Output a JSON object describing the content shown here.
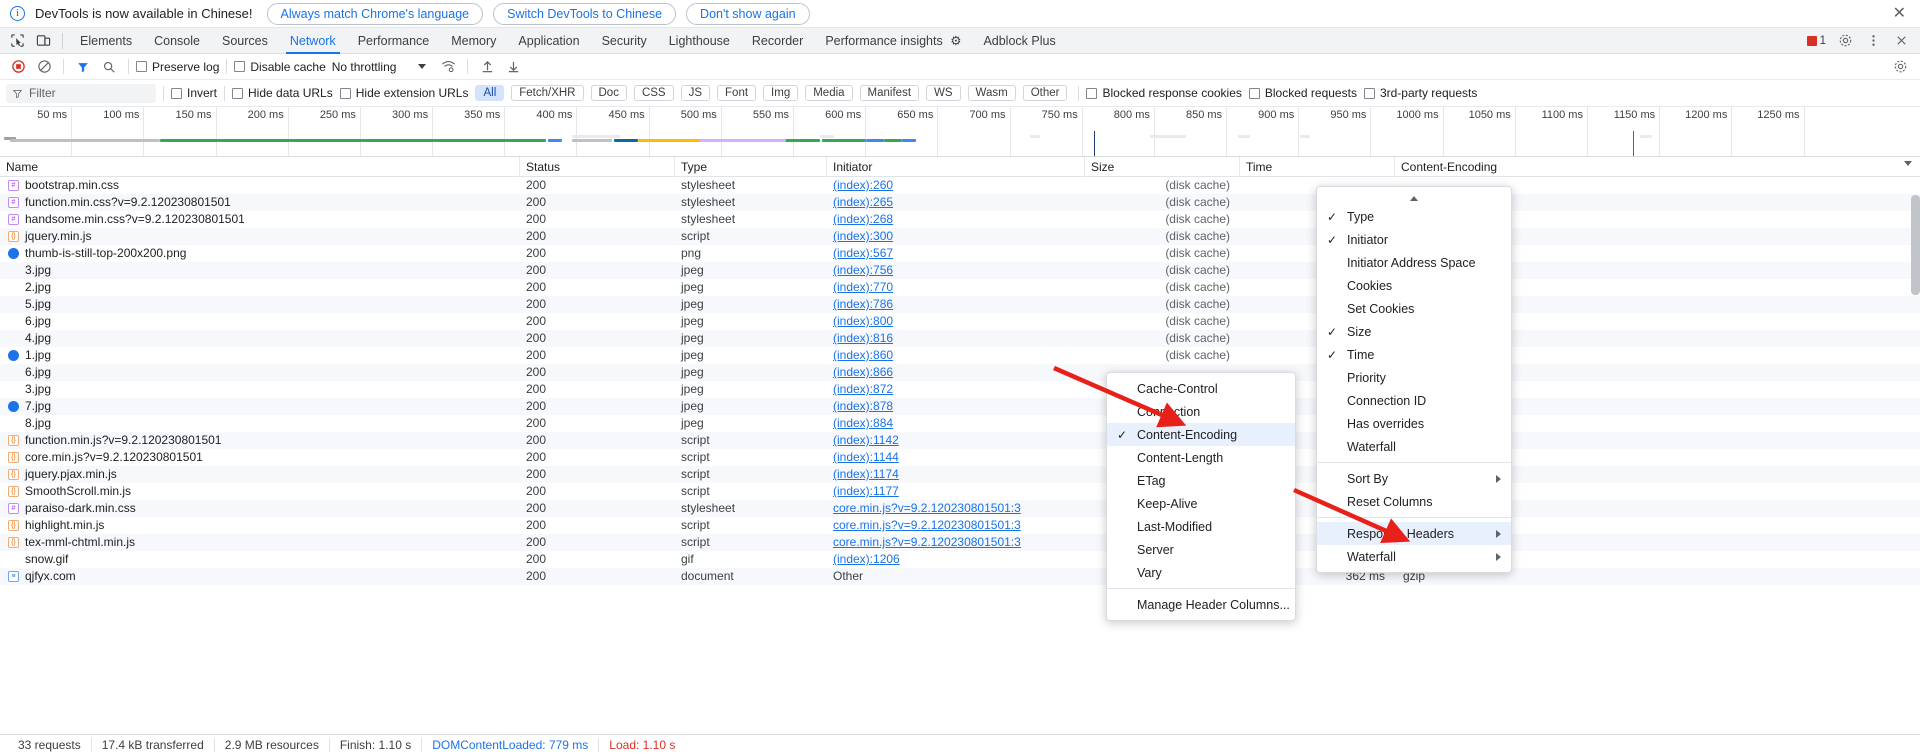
{
  "infobar": {
    "message": "DevTools is now available in Chinese!",
    "buttons": [
      "Always match Chrome's language",
      "Switch DevTools to Chinese",
      "Don't show again"
    ],
    "close": "✕"
  },
  "tabs": {
    "items": [
      "Elements",
      "Console",
      "Sources",
      "Network",
      "Performance",
      "Memory",
      "Application",
      "Security",
      "Lighthouse",
      "Recorder",
      "Performance insights",
      "Adblock Plus"
    ],
    "active": "Network",
    "error_count": "1",
    "settings_icon": "gear-icon",
    "more_icon": "kebab-icon",
    "close_icon": "close-icon"
  },
  "toolbar": {
    "record_icon": "record-stop-icon",
    "clear_icon": "clear-icon",
    "filter_icon": "filter-icon",
    "search_icon": "search-icon",
    "preserve_log": "Preserve log",
    "disable_cache": "Disable cache",
    "throttling": "No throttling",
    "wifi_icon": "network-conditions-icon",
    "import_icon": "import-har-icon",
    "export_icon": "export-har-icon",
    "settings_icon": "settings-gear-icon"
  },
  "filterbar": {
    "placeholder": "Filter",
    "invert": "Invert",
    "hide_data_urls": "Hide data URLs",
    "hide_extension_urls": "Hide extension URLs",
    "types": [
      "All",
      "Fetch/XHR",
      "Doc",
      "CSS",
      "JS",
      "Font",
      "Img",
      "Media",
      "Manifest",
      "WS",
      "Wasm",
      "Other"
    ],
    "selected_type": "All",
    "blocked_response_cookies": "Blocked response cookies",
    "blocked_requests": "Blocked requests",
    "third_party_requests": "3rd-party requests"
  },
  "timeline": {
    "ticks": [
      "50 ms",
      "100 ms",
      "150 ms",
      "200 ms",
      "250 ms",
      "300 ms",
      "350 ms",
      "400 ms",
      "450 ms",
      "500 ms",
      "550 ms",
      "600 ms",
      "650 ms",
      "700 ms",
      "750 ms",
      "800 ms",
      "850 ms",
      "900 ms",
      "950 ms",
      "1000 ms",
      "1050 ms",
      "1100 ms",
      "1150 ms",
      "1200 ms",
      "1250 ms"
    ]
  },
  "table": {
    "columns": [
      "Name",
      "Status",
      "Type",
      "Initiator",
      "Size",
      "Time",
      "Content-Encoding"
    ],
    "rows": [
      {
        "icon": "css",
        "name": "bootstrap.min.css",
        "status": "200",
        "type": "stylesheet",
        "initiator": "(index):260",
        "size": "(disk cache)",
        "time": "",
        "enc": ""
      },
      {
        "icon": "css",
        "name": "function.min.css?v=9.2.120230801501",
        "status": "200",
        "type": "stylesheet",
        "initiator": "(index):265",
        "size": "(disk cache)",
        "time": "",
        "enc": ""
      },
      {
        "icon": "css",
        "name": "handsome.min.css?v=9.2.120230801501",
        "status": "200",
        "type": "stylesheet",
        "initiator": "(index):268",
        "size": "(disk cache)",
        "time": "",
        "enc": ""
      },
      {
        "icon": "js",
        "name": "jquery.min.js",
        "status": "200",
        "type": "script",
        "initiator": "(index):300",
        "size": "(disk cache)",
        "time": "",
        "enc": ""
      },
      {
        "icon": "img-globe",
        "name": "thumb-is-still-top-200x200.png",
        "status": "200",
        "type": "png",
        "initiator": "(index):567",
        "size": "(disk cache)",
        "time": "",
        "enc": ""
      },
      {
        "icon": "dash",
        "name": "3.jpg",
        "status": "200",
        "type": "jpeg",
        "initiator": "(index):756",
        "size": "(disk cache)",
        "time": "",
        "enc": ""
      },
      {
        "icon": "dash",
        "name": "2.jpg",
        "status": "200",
        "type": "jpeg",
        "initiator": "(index):770",
        "size": "(disk cache)",
        "time": "",
        "enc": ""
      },
      {
        "icon": "dash",
        "name": "5.jpg",
        "status": "200",
        "type": "jpeg",
        "initiator": "(index):786",
        "size": "(disk cache)",
        "time": "",
        "enc": ""
      },
      {
        "icon": "dash",
        "name": "6.jpg",
        "status": "200",
        "type": "jpeg",
        "initiator": "(index):800",
        "size": "(disk cache)",
        "time": "",
        "enc": ""
      },
      {
        "icon": "dash",
        "name": "4.jpg",
        "status": "200",
        "type": "jpeg",
        "initiator": "(index):816",
        "size": "(disk cache)",
        "time": "",
        "enc": ""
      },
      {
        "icon": "img-globe",
        "name": "1.jpg",
        "status": "200",
        "type": "jpeg",
        "initiator": "(index):860",
        "size": "(disk cache)",
        "time": "",
        "enc": ""
      },
      {
        "icon": "dash",
        "name": "6.jpg",
        "status": "200",
        "type": "jpeg",
        "initiator": "(index):866",
        "size": "",
        "time": "",
        "enc": ""
      },
      {
        "icon": "dash",
        "name": "3.jpg",
        "status": "200",
        "type": "jpeg",
        "initiator": "(index):872",
        "size": "",
        "time": "",
        "enc": ""
      },
      {
        "icon": "img-globe",
        "name": "7.jpg",
        "status": "200",
        "type": "jpeg",
        "initiator": "(index):878",
        "size": "",
        "time": "",
        "enc": ""
      },
      {
        "icon": "dash",
        "name": "8.jpg",
        "status": "200",
        "type": "jpeg",
        "initiator": "(index):884",
        "size": "",
        "time": "",
        "enc": ""
      },
      {
        "icon": "js",
        "name": "function.min.js?v=9.2.120230801501",
        "status": "200",
        "type": "script",
        "initiator": "(index):1142",
        "size": "",
        "time": "",
        "enc": ""
      },
      {
        "icon": "js",
        "name": "core.min.js?v=9.2.120230801501",
        "status": "200",
        "type": "script",
        "initiator": "(index):1144",
        "size": "",
        "time": "",
        "enc": ""
      },
      {
        "icon": "js",
        "name": "jquery.pjax.min.js",
        "status": "200",
        "type": "script",
        "initiator": "(index):1174",
        "size": "",
        "time": "",
        "enc": ""
      },
      {
        "icon": "js",
        "name": "SmoothScroll.min.js",
        "status": "200",
        "type": "script",
        "initiator": "(index):1177",
        "size": "",
        "time": "",
        "enc": ""
      },
      {
        "icon": "css",
        "name": "paraiso-dark.min.css",
        "status": "200",
        "type": "stylesheet",
        "initiator": "core.min.js?v=9.2.120230801501:3",
        "size": "",
        "time": "",
        "enc": ""
      },
      {
        "icon": "js",
        "name": "highlight.min.js",
        "status": "200",
        "type": "script",
        "initiator": "core.min.js?v=9.2.120230801501:3",
        "size": "",
        "time": "",
        "enc": ""
      },
      {
        "icon": "js",
        "name": "tex-mml-chtml.min.js",
        "status": "200",
        "type": "script",
        "initiator": "core.min.js?v=9.2.120230801501:3",
        "size": "",
        "time": "",
        "enc": ""
      },
      {
        "icon": "dash",
        "name": "snow.gif",
        "status": "200",
        "type": "gif",
        "initiator": "(index):1206",
        "size": "",
        "time": "",
        "enc": ""
      },
      {
        "icon": "doc",
        "name": "qjfyx.com",
        "status": "200",
        "type": "document",
        "initiator": "Other",
        "size": "",
        "time": "362 ms",
        "enc": "gzip"
      }
    ]
  },
  "context_menu_left": {
    "items": [
      {
        "label": "Cache-Control",
        "checked": false
      },
      {
        "label": "Connection",
        "checked": false
      },
      {
        "label": "Content-Encoding",
        "checked": true,
        "highlight": true
      },
      {
        "label": "Content-Length",
        "checked": false
      },
      {
        "label": "ETag",
        "checked": false
      },
      {
        "label": "Keep-Alive",
        "checked": false
      },
      {
        "label": "Last-Modified",
        "checked": false
      },
      {
        "label": "Server",
        "checked": false
      },
      {
        "label": "Vary",
        "checked": false
      }
    ],
    "footer": "Manage Header Columns..."
  },
  "context_menu_right": {
    "items": [
      {
        "label": "Type",
        "checked": true,
        "submenu": false
      },
      {
        "label": "Initiator",
        "checked": true,
        "submenu": false
      },
      {
        "label": "Initiator Address Space",
        "checked": false,
        "submenu": false
      },
      {
        "label": "Cookies",
        "checked": false,
        "submenu": false
      },
      {
        "label": "Set Cookies",
        "checked": false,
        "submenu": false
      },
      {
        "label": "Size",
        "checked": true,
        "submenu": false
      },
      {
        "label": "Time",
        "checked": true,
        "submenu": false
      },
      {
        "label": "Priority",
        "checked": false,
        "submenu": false
      },
      {
        "label": "Connection ID",
        "checked": false,
        "submenu": false
      },
      {
        "label": "Has overrides",
        "checked": false,
        "submenu": false
      },
      {
        "label": "Waterfall",
        "checked": false,
        "submenu": false
      }
    ],
    "group2": [
      {
        "label": "Sort By",
        "checked": false,
        "submenu": true
      },
      {
        "label": "Reset Columns",
        "checked": false,
        "submenu": false
      }
    ],
    "group3": [
      {
        "label": "Response Headers",
        "checked": false,
        "submenu": true,
        "highlight": true
      },
      {
        "label": "Waterfall",
        "checked": false,
        "submenu": true
      }
    ]
  },
  "statusbar": {
    "requests": "33 requests",
    "transferred": "17.4 kB transferred",
    "resources": "2.9 MB resources",
    "finish": "Finish: 1.10 s",
    "dcl": "DOMContentLoaded: 779 ms",
    "load": "Load: 1.10 s"
  }
}
